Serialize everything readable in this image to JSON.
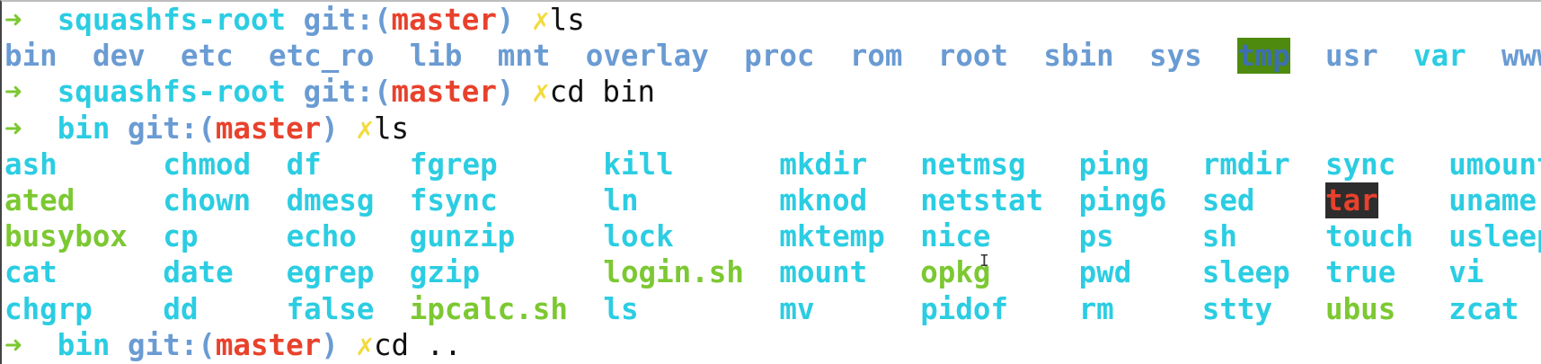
{
  "prompts": [
    {
      "arrow": "➜",
      "dir": "squashfs-root",
      "git_prefix": "git:(",
      "branch": "master",
      "git_suffix": ")",
      "dirty": "✗",
      "command": "ls"
    },
    {
      "arrow": "➜",
      "dir": "squashfs-root",
      "git_prefix": "git:(",
      "branch": "master",
      "git_suffix": ")",
      "dirty": "✗",
      "command": "cd bin"
    },
    {
      "arrow": "➜",
      "dir": "bin",
      "git_prefix": "git:(",
      "branch": "master",
      "git_suffix": ")",
      "dirty": "✗",
      "command": "ls"
    },
    {
      "arrow": "➜",
      "dir": "bin",
      "git_prefix": "git:(",
      "branch": "master",
      "git_suffix": ")",
      "dirty": "✗",
      "command": "cd .."
    }
  ],
  "root_listing": [
    {
      "name": "bin",
      "type": "dir"
    },
    {
      "name": "dev",
      "type": "dir"
    },
    {
      "name": "etc",
      "type": "dir"
    },
    {
      "name": "etc_ro",
      "type": "dir"
    },
    {
      "name": "lib",
      "type": "dir"
    },
    {
      "name": "mnt",
      "type": "dir"
    },
    {
      "name": "overlay",
      "type": "dir"
    },
    {
      "name": "proc",
      "type": "dir"
    },
    {
      "name": "rom",
      "type": "dir"
    },
    {
      "name": "root",
      "type": "dir"
    },
    {
      "name": "sbin",
      "type": "dir"
    },
    {
      "name": "sys",
      "type": "dir"
    },
    {
      "name": "tmp",
      "type": "sticky"
    },
    {
      "name": "usr",
      "type": "dir"
    },
    {
      "name": "var",
      "type": "link"
    },
    {
      "name": "www",
      "type": "dir"
    }
  ],
  "bin_listing_columns": [
    [
      {
        "name": "ash",
        "type": "link"
      },
      {
        "name": "ated",
        "type": "exec"
      },
      {
        "name": "busybox",
        "type": "exec"
      },
      {
        "name": "cat",
        "type": "link"
      },
      {
        "name": "chgrp",
        "type": "link"
      }
    ],
    [
      {
        "name": "chmod",
        "type": "link"
      },
      {
        "name": "chown",
        "type": "link"
      },
      {
        "name": "cp",
        "type": "link"
      },
      {
        "name": "date",
        "type": "link"
      },
      {
        "name": "dd",
        "type": "link"
      }
    ],
    [
      {
        "name": "df",
        "type": "link"
      },
      {
        "name": "dmesg",
        "type": "link"
      },
      {
        "name": "echo",
        "type": "link"
      },
      {
        "name": "egrep",
        "type": "link"
      },
      {
        "name": "false",
        "type": "link"
      }
    ],
    [
      {
        "name": "fgrep",
        "type": "link"
      },
      {
        "name": "fsync",
        "type": "link"
      },
      {
        "name": "gunzip",
        "type": "link"
      },
      {
        "name": "gzip",
        "type": "link"
      },
      {
        "name": "ipcalc.sh",
        "type": "exec"
      }
    ],
    [
      {
        "name": "kill",
        "type": "link"
      },
      {
        "name": "ln",
        "type": "link"
      },
      {
        "name": "lock",
        "type": "link"
      },
      {
        "name": "login.sh",
        "type": "exec"
      },
      {
        "name": "ls",
        "type": "link"
      }
    ],
    [
      {
        "name": "mkdir",
        "type": "link"
      },
      {
        "name": "mknod",
        "type": "link"
      },
      {
        "name": "mktemp",
        "type": "link"
      },
      {
        "name": "mount",
        "type": "link"
      },
      {
        "name": "mv",
        "type": "link"
      }
    ],
    [
      {
        "name": "netmsg",
        "type": "link"
      },
      {
        "name": "netstat",
        "type": "link"
      },
      {
        "name": "nice",
        "type": "link"
      },
      {
        "name": "opkg",
        "type": "exec"
      },
      {
        "name": "pidof",
        "type": "link"
      }
    ],
    [
      {
        "name": "ping",
        "type": "link"
      },
      {
        "name": "ping6",
        "type": "link"
      },
      {
        "name": "ps",
        "type": "link"
      },
      {
        "name": "pwd",
        "type": "link"
      },
      {
        "name": "rm",
        "type": "link"
      }
    ],
    [
      {
        "name": "rmdir",
        "type": "link"
      },
      {
        "name": "sed",
        "type": "link"
      },
      {
        "name": "sh",
        "type": "link"
      },
      {
        "name": "sleep",
        "type": "link"
      },
      {
        "name": "stty",
        "type": "link"
      }
    ],
    [
      {
        "name": "sync",
        "type": "link"
      },
      {
        "name": "tar",
        "type": "special"
      },
      {
        "name": "touch",
        "type": "link"
      },
      {
        "name": "true",
        "type": "link"
      },
      {
        "name": "ubus",
        "type": "exec"
      }
    ],
    [
      {
        "name": "umount",
        "type": "link"
      },
      {
        "name": "uname",
        "type": "link"
      },
      {
        "name": "usleep",
        "type": "link"
      },
      {
        "name": "vi",
        "type": "link"
      },
      {
        "name": "zcat",
        "type": "link"
      }
    ]
  ],
  "colors": {
    "arrow": "#7cc832",
    "dir_prompt": "#2bcde2",
    "git": "#6a9bd3",
    "branch": "#e8412c",
    "dirty": "#f3da3c",
    "directory": "#6a9bd3",
    "symlink": "#2bcde2",
    "executable": "#7cc832",
    "sticky_bg": "#4e8a0e",
    "special_bg": "#2d2d2d"
  },
  "mouse_cursor": "text-cursor-icon"
}
